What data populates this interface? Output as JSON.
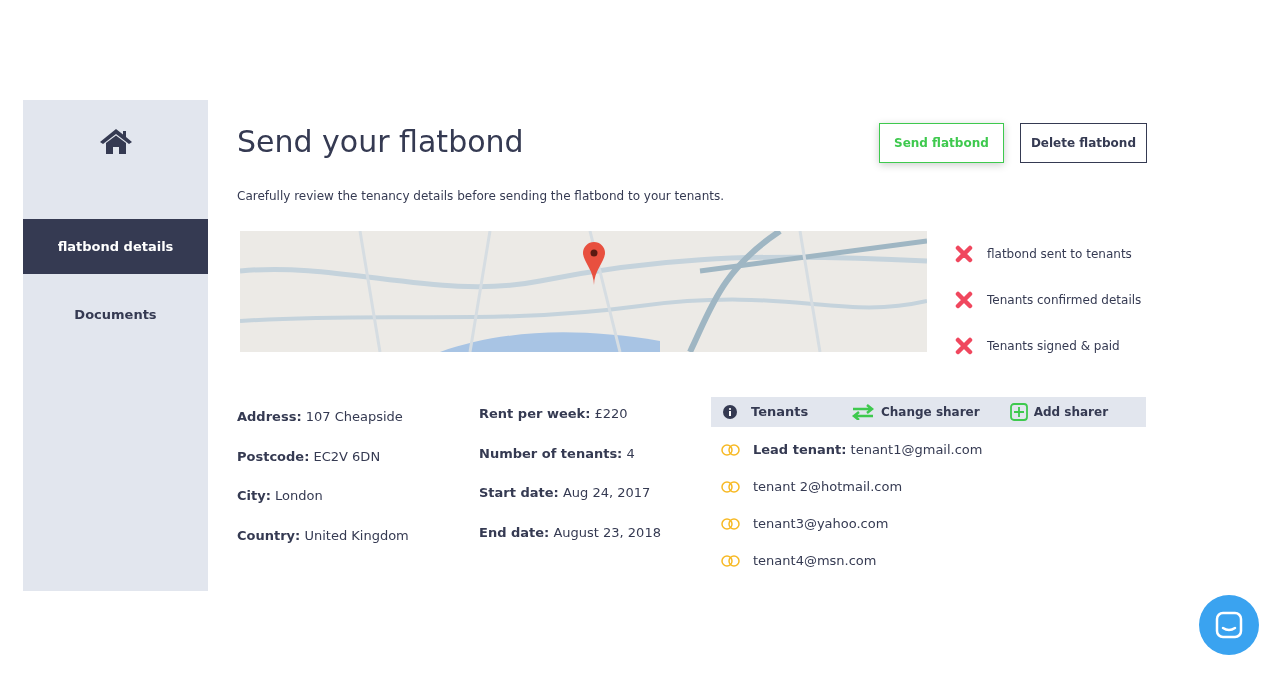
{
  "sidebar": {
    "items": [
      {
        "label": "flatbond details",
        "selected": true
      },
      {
        "label": "Documents",
        "selected": false
      }
    ]
  },
  "title": "Send your flatbond",
  "buttons": [
    {
      "label": "Send flatbond",
      "kind": "primary"
    },
    {
      "label": "Delete flatbond",
      "kind": "secondary"
    }
  ],
  "description": "Carefully review the tenancy details before sending the flatbond to your tenants.",
  "statuses": [
    {
      "label": "flatbond sent to tenants",
      "done": false
    },
    {
      "label": "Tenants confirmed details",
      "done": false
    },
    {
      "label": "Tenants signed & paid",
      "done": false
    }
  ],
  "details": [
    [
      {
        "label": "Address:",
        "value": "107 Cheapside"
      },
      {
        "label": "Postcode:",
        "value": "EC2V 6DN"
      },
      {
        "label": "City:",
        "value": "London"
      },
      {
        "label": "Country:",
        "value": "United Kingdom"
      }
    ],
    [
      {
        "label": "Rent per week:",
        "value": "£220"
      },
      {
        "label": "Number of tenants:",
        "value": "4"
      },
      {
        "label": "Start date:",
        "value": "Aug 24, 2017"
      },
      {
        "label": "End date:",
        "value": "August 23, 2018"
      }
    ]
  ],
  "tenants": {
    "title": "Tenants",
    "actions": [
      {
        "label": "Change sharer",
        "kind": "swap"
      },
      {
        "label": "Add sharer",
        "kind": "add"
      }
    ],
    "list": [
      {
        "text": "**Lead tenant:** tenant1@gmail.com"
      },
      {
        "text": "tenant 2@hotmail.com"
      },
      {
        "text": "tenant3@yahoo.com"
      },
      {
        "text": "tenant4@msn.com"
      }
    ]
  }
}
